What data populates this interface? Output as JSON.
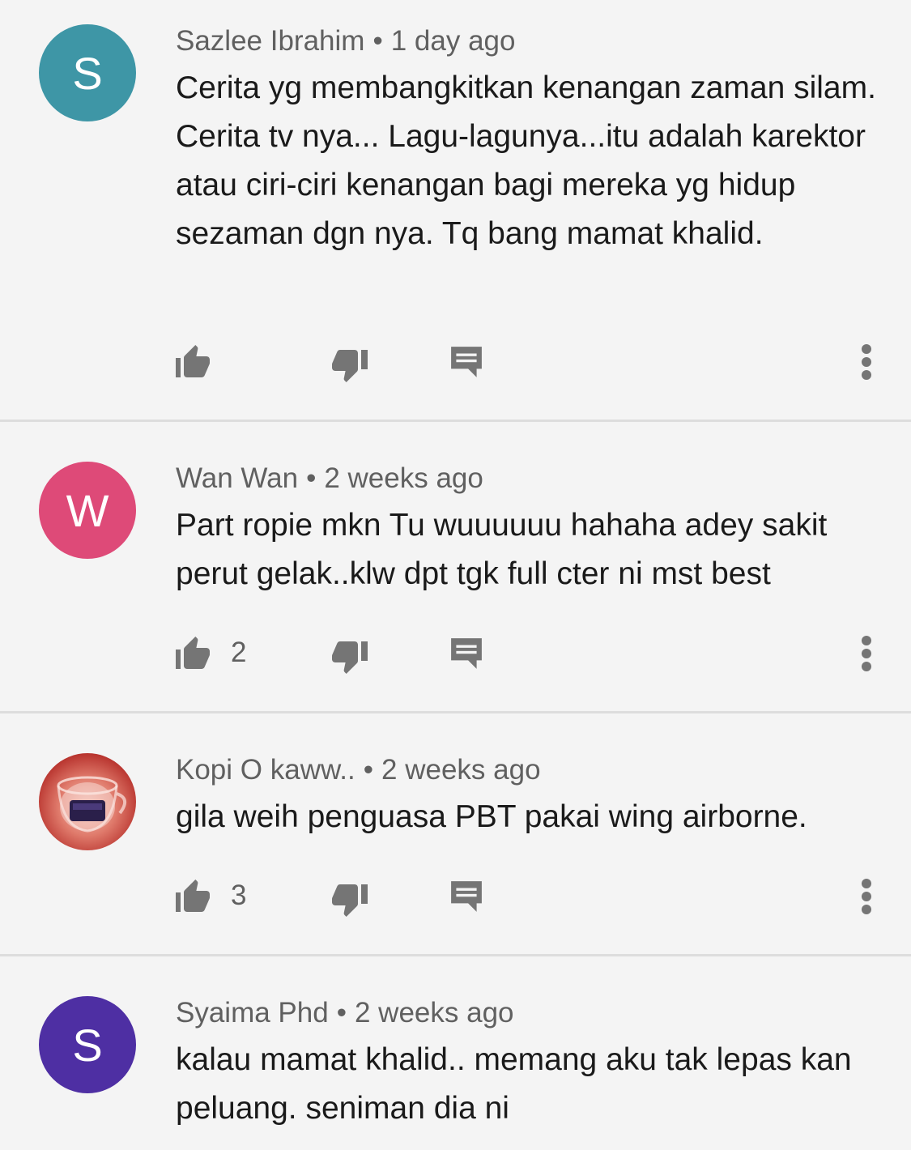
{
  "colors": {
    "background": "#f4f4f4",
    "icon": "#757575",
    "meta_text": "#606060"
  },
  "comments": [
    {
      "avatar_letter": "S",
      "avatar_color": "#3e96a6",
      "author": "Sazlee Ibrahim",
      "separator": "•",
      "time": "1 day ago",
      "text": "Cerita yg membangkitkan kenangan zaman silam. Cerita  tv nya... Lagu-lagunya...itu adalah karektor atau ciri-ciri kenangan bagi mereka yg hidup sezaman dgn nya. Tq bang mamat khalid.",
      "likes": ""
    },
    {
      "avatar_letter": "W",
      "avatar_color": "#de4a78",
      "author": "Wan Wan",
      "separator": "•",
      "time": "2 weeks ago",
      "text": "Part ropie mkn Tu wuuuuuu hahaha adey sakit perut gelak..klw dpt tgk full cter ni mst best",
      "likes": "2"
    },
    {
      "avatar_letter": "",
      "avatar_color": "#c33a32",
      "author": "Kopi O kaww..",
      "separator": "•",
      "time": "2 weeks ago",
      "text": "gila weih penguasa PBT pakai wing airborne.",
      "likes": "3"
    },
    {
      "avatar_letter": "S",
      "avatar_color": "#4e2fa3",
      "author": "Syaima Phd",
      "separator": "•",
      "time": "2 weeks ago",
      "text": "kalau mamat khalid.. memang aku tak lepas kan peluang. seniman dia ni",
      "likes": ""
    }
  ],
  "icons": {
    "like": "thumbs-up-icon",
    "dislike": "thumbs-down-icon",
    "reply": "reply-comment-icon",
    "more": "more-vertical-icon"
  }
}
